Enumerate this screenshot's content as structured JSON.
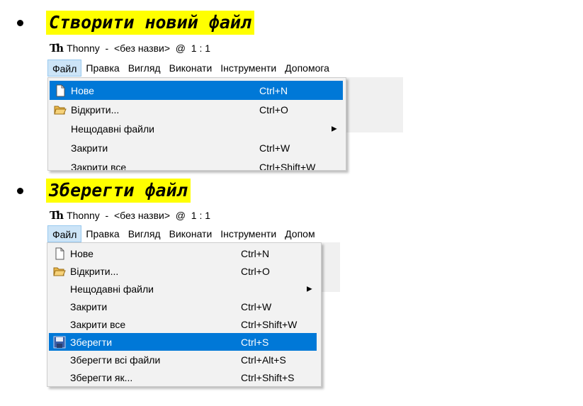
{
  "section1": {
    "heading": "Створити новий файл",
    "title": "Thonny  -  <без назви>  @  1 : 1",
    "menu": [
      "Файл",
      "Правка",
      "Вигляд",
      "Виконати",
      "Інструменти",
      "Допомога"
    ],
    "items": [
      {
        "label": "Нове",
        "shortcut": "Ctrl+N",
        "icon": "new-file-icon"
      },
      {
        "label": "Відкрити...",
        "shortcut": "Ctrl+O",
        "icon": "folder-open-icon"
      },
      {
        "label": "Нещодавні файли",
        "shortcut": "",
        "icon": ""
      },
      {
        "label": "Закрити",
        "shortcut": "Ctrl+W",
        "icon": ""
      },
      {
        "label": "Закрити все",
        "shortcut": "Ctrl+Shift+W",
        "icon": ""
      }
    ],
    "selected_item": "Нове"
  },
  "section2": {
    "heading": "Зберегти файл",
    "title": "Thonny  -  <без назви>  @  1 : 1",
    "menu": [
      "Файл",
      "Правка",
      "Вигляд",
      "Виконати",
      "Інструменти",
      "Допом"
    ],
    "items": [
      {
        "label": "Нове",
        "shortcut": "Ctrl+N",
        "icon": "new-file-icon"
      },
      {
        "label": "Відкрити...",
        "shortcut": "Ctrl+O",
        "icon": "folder-open-icon"
      },
      {
        "label": "Нещодавні файли",
        "shortcut": "",
        "icon": ""
      },
      {
        "label": "Закрити",
        "shortcut": "Ctrl+W",
        "icon": ""
      },
      {
        "label": "Закрити все",
        "shortcut": "Ctrl+Shift+W",
        "icon": ""
      },
      {
        "label": "Зберегти",
        "shortcut": "Ctrl+S",
        "icon": "save-icon"
      },
      {
        "label": "Зберегти всі файли",
        "shortcut": "Ctrl+Alt+S",
        "icon": ""
      },
      {
        "label": "Зберегти як...",
        "shortcut": "Ctrl+Shift+S",
        "icon": ""
      }
    ],
    "selected_item": "Зберегти"
  },
  "colors": {
    "highlight_heading": "#ffff00",
    "menu_selected": "#0078d7",
    "menu_active": "#cce4f7"
  }
}
